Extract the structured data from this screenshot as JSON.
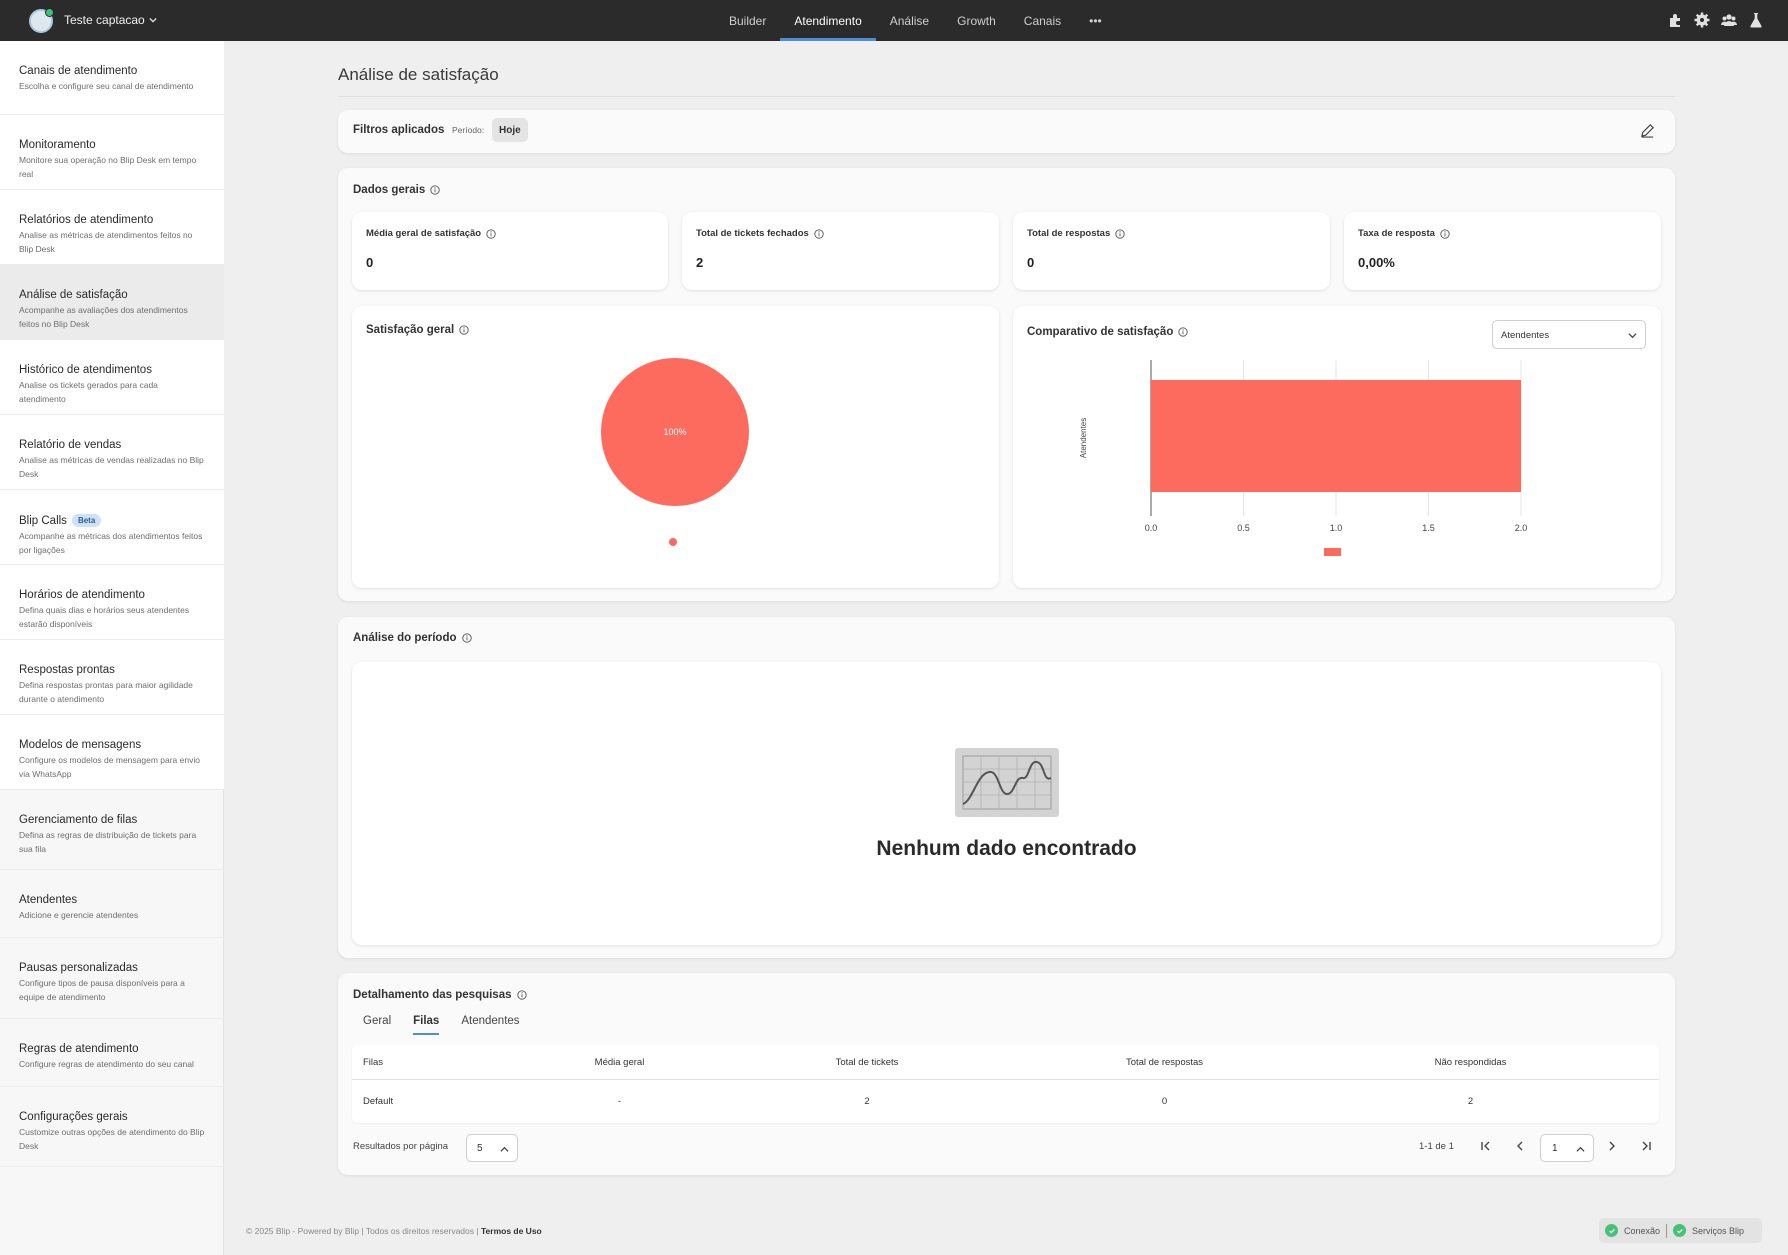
{
  "header": {
    "account_name": "Teste captacao",
    "nav": [
      "Builder",
      "Atendimento",
      "Análise",
      "Growth",
      "Canais"
    ],
    "active_nav": "Atendimento",
    "more_label": "•••"
  },
  "sidebar": {
    "items": [
      {
        "title": "Canais de atendimento",
        "desc": "Escolha e configure seu canal de atendimento"
      },
      {
        "title": "Monitoramento",
        "desc": "Monitore sua operação no Blip Desk em tempo real"
      },
      {
        "title": "Relatórios de atendimento",
        "desc": "Analise as métricas de atendimentos feitos no Blip Desk"
      },
      {
        "title": "Análise de satisfação",
        "desc": "Acompanhe as avaliações dos atendimentos feitos no Blip Desk"
      },
      {
        "title": "Histórico de atendimentos",
        "desc": "Analise os tickets gerados para cada atendimento"
      },
      {
        "title": "Relatório de vendas",
        "desc": "Analise as métricas de vendas realizadas no Blip Desk"
      },
      {
        "title": "Blip Calls",
        "badge": "Beta",
        "desc": "Acompanhe as métricas dos atendimentos feitos por ligações"
      },
      {
        "title": "Horários de atendimento",
        "desc": "Defina quais dias e horários seus atendentes estarão disponíveis"
      },
      {
        "title": "Respostas prontas",
        "desc": "Defina respostas prontas para maior agilidade durante o atendimento"
      },
      {
        "title": "Modelos de mensagens",
        "desc": "Configure os modelos de mensagem para envio via WhatsApp"
      },
      {
        "title": "Gerenciamento de filas",
        "desc": "Defina as regras de distribuição de tickets para sua fila"
      },
      {
        "title": "Atendentes",
        "desc": "Adicione e gerencie atendentes"
      },
      {
        "title": "Pausas personalizadas",
        "desc": "Configure tipos de pausa disponíveis para a equipe de atendimento"
      },
      {
        "title": "Regras de atendimento",
        "desc": "Configure regras de atendimento do seu canal"
      },
      {
        "title": "Configurações gerais",
        "desc": "Customize outras opções de atendimento do Blip Desk"
      }
    ]
  },
  "main": {
    "title": "Análise de satisfação",
    "filters": {
      "label": "Filtros aplicados",
      "period_label": "Período:",
      "period_value": "Hoje"
    },
    "general": {
      "title": "Dados gerais",
      "metrics": [
        {
          "label": "Média geral de satisfação",
          "value": "0"
        },
        {
          "label": "Total de tickets fechados",
          "value": "2"
        },
        {
          "label": "Total de respostas",
          "value": "0"
        },
        {
          "label": "Taxa de resposta",
          "value": "0,00%"
        }
      ]
    },
    "satisfaction": {
      "title": "Satisfação geral"
    },
    "comparison": {
      "title": "Comparativo de satisfação",
      "select_value": "Atendentes"
    },
    "period": {
      "title": "Análise do período",
      "empty_text": "Nenhum dado encontrado"
    },
    "detail": {
      "title": "Detalhamento das pesquisas",
      "tabs": [
        "Geral",
        "Filas",
        "Atendentes"
      ],
      "active_tab": "Filas",
      "columns": [
        "Filas",
        "Média geral",
        "Total de tickets",
        "Total de respostas",
        "Não respondidas"
      ],
      "rows": [
        [
          "Default",
          "-",
          "2",
          "0",
          "2"
        ]
      ],
      "rpp_label": "Resultados por página",
      "rpp_value": "5",
      "pager_count": "1-1 de 1",
      "page_value": "1"
    }
  },
  "footer": {
    "text": "© 2025 Blip - Powered by Blip | Todos os direitos reservados |",
    "link": "Termos de Uso",
    "status": [
      "Conexão",
      "Serviços Blip"
    ]
  },
  "colors": {
    "accent": "#4c8ed9",
    "chart": "#fd6b5e",
    "topbar": "#2b2b2b",
    "ok": "#48c078"
  },
  "chart_data": [
    {
      "type": "pie",
      "title": "Satisfação geral",
      "categories": [
        ""
      ],
      "values": [
        100
      ],
      "labels": [
        "100%"
      ]
    },
    {
      "type": "bar",
      "orientation": "horizontal",
      "title": "Comparativo de satisfação",
      "categories": [
        "Atendentes"
      ],
      "values": [
        2
      ],
      "ylabel": "Atendentes",
      "xlim": [
        0,
        2
      ],
      "xticks": [
        "0.0",
        "0.5",
        "1.0",
        "1.5",
        "2.0"
      ],
      "grid": true
    }
  ]
}
